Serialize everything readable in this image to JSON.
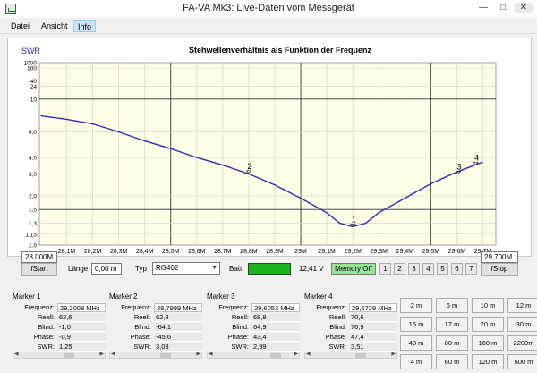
{
  "window": {
    "title": "FA-VA Mk3:    Live-Daten vom Messgerät"
  },
  "menu": {
    "items": [
      "Datei",
      "Ansicht",
      "Info"
    ]
  },
  "chart_data": {
    "type": "line",
    "title": "Stehwellenverhältnis als Funktion der Frequenz",
    "ylabel": "SWR",
    "xlabel": "",
    "y_scale": "log",
    "ylim": [
      1.0,
      1000
    ],
    "xlim": [
      27.995,
      29.75
    ],
    "y_ticks": [
      "1.0",
      "1,15",
      "1,3",
      "1,5",
      "2,0",
      "3,0",
      "4,0",
      "6,0",
      "10",
      "24",
      "40",
      "100",
      "1000"
    ],
    "x_ticks": [
      "28,1M",
      "28,2M",
      "28,3M",
      "28,4M",
      "28,5M",
      "28,6M",
      "28,7M",
      "28,8M",
      "28,9M",
      "29M",
      "29,1M",
      "29,2M",
      "29,3M",
      "29,4M",
      "29,5M",
      "29,6M",
      "29,7M"
    ],
    "grid": true,
    "series": [
      {
        "color": "#2b2bb8",
        "x": [
          28.0,
          28.1,
          28.2,
          28.3,
          28.4,
          28.5,
          28.6,
          28.7,
          28.8,
          28.9,
          29.0,
          29.1,
          29.15,
          29.2,
          29.25,
          29.3,
          29.4,
          29.5,
          29.6,
          29.7
        ],
        "y": [
          7.7,
          7.3,
          6.8,
          6.0,
          5.2,
          4.6,
          4.0,
          3.5,
          3.0,
          2.45,
          1.9,
          1.45,
          1.3,
          1.25,
          1.3,
          1.45,
          1.9,
          2.5,
          3.1,
          3.7
        ]
      }
    ],
    "markers": [
      {
        "label": "1",
        "x": 29.2008,
        "y": 1.25
      },
      {
        "label": "2",
        "x": 28.7999,
        "y": 3.03
      },
      {
        "label": "3",
        "x": 29.6053,
        "y": 2.99
      },
      {
        "label": "4",
        "x": 29.6729,
        "y": 3.51
      }
    ]
  },
  "controls": {
    "fstart_value": "28,000M",
    "fstop_value": "29,700M",
    "fstart_button": "fStart",
    "fstop_button": "fStop",
    "laenge_label": "Länge",
    "laenge_value": "0,00 m",
    "typ_label": "Typ",
    "typ_value": "RG402",
    "batt_label": "Batt",
    "voltage": "12,41 V",
    "memory_off": "Memory Off",
    "memory_slots": [
      "1",
      "2",
      "3",
      "4",
      "5",
      "6",
      "7"
    ]
  },
  "markers": [
    {
      "title": "Marker 1",
      "frequenz": "29,2008 MHz",
      "reell": "62,6",
      "blind": "-1,0",
      "phase": "-0,9",
      "swr": "1,25"
    },
    {
      "title": "Marker 2",
      "frequenz": "28,7999 MHz",
      "reell": "62,8",
      "blind": "-64,1",
      "phase": "-45,6",
      "swr": "3,03"
    },
    {
      "title": "Marker 3",
      "frequenz": "29,6053 MHz",
      "reell": "68,8",
      "blind": "64,9",
      "phase": "43,4",
      "swr": "2,99"
    },
    {
      "title": "Marker 4",
      "frequenz": "29,6729 MHz",
      "reell": "70,6",
      "blind": "76,9",
      "phase": "47,4",
      "swr": "3,51"
    }
  ],
  "marker_labels": {
    "frequenz": "Frequenz:",
    "reell": "Reell:",
    "blind": "Blind:",
    "phase": "Phase:",
    "swr": "SWR:"
  },
  "bands": [
    "2 m",
    "6 m",
    "10 m",
    "12 m",
    "15 m",
    "17 m",
    "20 m",
    "30 m",
    "40 m",
    "80 m",
    "160 m",
    "2200m",
    "4 m",
    "60 m",
    "120 m",
    "600 m"
  ],
  "colors": {
    "accent": "#1a1aa6",
    "curve": "#2b2bb8",
    "chart_bg": "#fffde6",
    "battery": "#1db31d",
    "memory": "#98e198"
  }
}
